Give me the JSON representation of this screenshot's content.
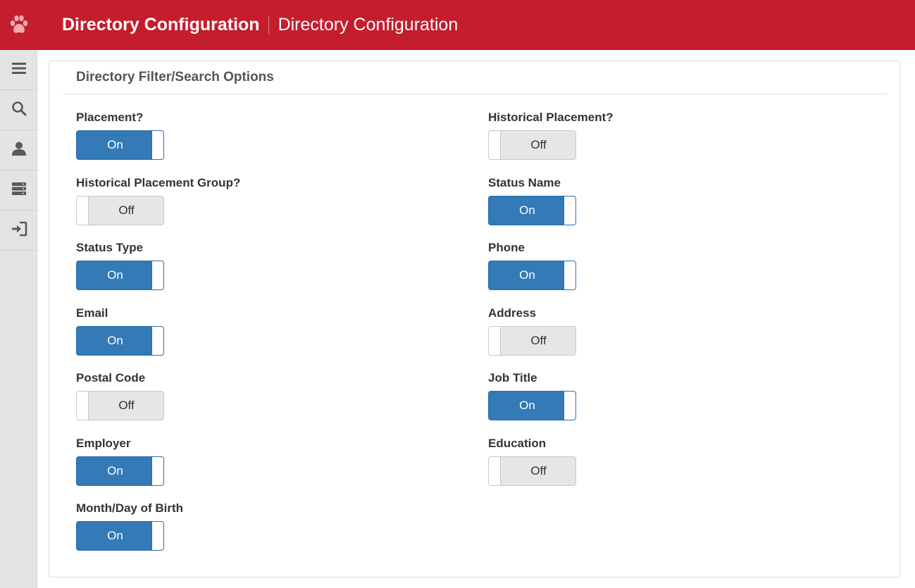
{
  "header": {
    "title": "Directory Configuration",
    "subtitle": "Directory Configuration",
    "logo_icon": "paw-icon",
    "background_color": "#c31d2e"
  },
  "sidebar": {
    "items": [
      {
        "name": "menu",
        "icon": "hamburger-icon"
      },
      {
        "name": "search",
        "icon": "search-icon"
      },
      {
        "name": "profile",
        "icon": "user-icon"
      },
      {
        "name": "servers",
        "icon": "server-icon"
      },
      {
        "name": "logout",
        "icon": "sign-in-icon"
      }
    ]
  },
  "panel": {
    "title": "Directory Filter/Search Options"
  },
  "options": [
    {
      "label": "Placement?",
      "state": "On",
      "on": true
    },
    {
      "label": "Historical Placement?",
      "state": "Off",
      "on": false
    },
    {
      "label": "Historical Placement Group?",
      "state": "Off",
      "on": false
    },
    {
      "label": "Status Name",
      "state": "On",
      "on": true
    },
    {
      "label": "Status Type",
      "state": "On",
      "on": true
    },
    {
      "label": "Phone",
      "state": "On",
      "on": true
    },
    {
      "label": "Email",
      "state": "On",
      "on": true
    },
    {
      "label": "Address",
      "state": "Off",
      "on": false
    },
    {
      "label": "Postal Code",
      "state": "Off",
      "on": false
    },
    {
      "label": "Job Title",
      "state": "On",
      "on": true
    },
    {
      "label": "Employer",
      "state": "On",
      "on": true
    },
    {
      "label": "Education",
      "state": "Off",
      "on": false
    },
    {
      "label": "Month/Day of Birth",
      "state": "On",
      "on": true
    }
  ],
  "colors": {
    "accent": "#337ab7",
    "header": "#c31d2e",
    "toggle_off": "#e6e6e6"
  }
}
